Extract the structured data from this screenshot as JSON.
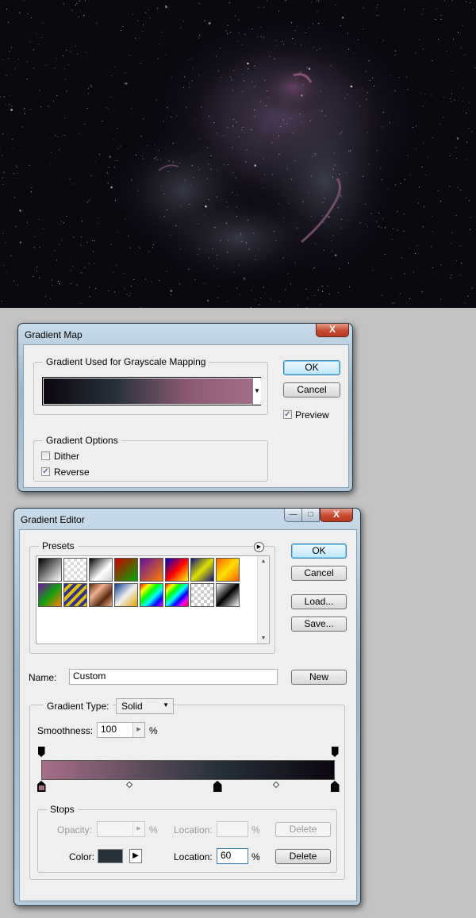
{
  "gradient_map": {
    "title": "Gradient Map",
    "close_label": "X",
    "group_gradient": "Gradient Used for Grayscale Mapping",
    "ok_label": "OK",
    "cancel_label": "Cancel",
    "preview_label": "Preview",
    "preview_checked": true,
    "group_options": "Gradient Options",
    "dither_label": "Dither",
    "dither_checked": false,
    "reverse_label": "Reverse",
    "reverse_checked": true,
    "gradient_colors": [
      "#0c0610",
      "#27313a",
      "#8a5a74",
      "#a66f89"
    ]
  },
  "gradient_editor": {
    "title": "Gradient Editor",
    "close_label": "X",
    "minimize_label": "—",
    "maximize_label": "□",
    "presets_label": "Presets",
    "ok_label": "OK",
    "cancel_label": "Cancel",
    "load_label": "Load...",
    "save_label": "Save...",
    "name_label": "Name:",
    "name_value": "Custom",
    "new_label": "New",
    "gradient_type_label": "Gradient Type:",
    "gradient_type_value": "Solid",
    "smoothness_label": "Smoothness:",
    "smoothness_value": "100",
    "percent": "%",
    "stops_label": "Stops",
    "opacity_label": "Opacity:",
    "location_label": "Location:",
    "delete_label": "Delete",
    "color_label": "Color:",
    "color_location_value": "60",
    "selected_color": "#27313a",
    "gradient_colors": [
      "#a66f89",
      "#8a5a74",
      "#27313a",
      "#0c0610"
    ],
    "color_stops": [
      {
        "location": 0,
        "color": "#a66f89"
      },
      {
        "location": 60,
        "color": "#27313a",
        "selected": true
      },
      {
        "location": 100,
        "color": "#0c0610"
      }
    ],
    "opacity_stops": [
      0,
      100
    ],
    "midpoints": [
      30,
      80
    ]
  }
}
